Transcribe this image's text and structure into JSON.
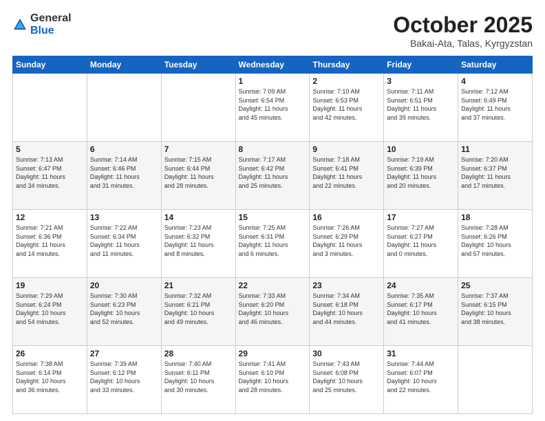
{
  "header": {
    "logo_general": "General",
    "logo_blue": "Blue",
    "month_title": "October 2025",
    "location": "Bakai-Ata, Talas, Kyrgyzstan"
  },
  "weekdays": [
    "Sunday",
    "Monday",
    "Tuesday",
    "Wednesday",
    "Thursday",
    "Friday",
    "Saturday"
  ],
  "weeks": [
    [
      {
        "day": "",
        "info": ""
      },
      {
        "day": "",
        "info": ""
      },
      {
        "day": "",
        "info": ""
      },
      {
        "day": "1",
        "info": "Sunrise: 7:09 AM\nSunset: 6:54 PM\nDaylight: 11 hours\nand 45 minutes."
      },
      {
        "day": "2",
        "info": "Sunrise: 7:10 AM\nSunset: 6:53 PM\nDaylight: 11 hours\nand 42 minutes."
      },
      {
        "day": "3",
        "info": "Sunrise: 7:11 AM\nSunset: 6:51 PM\nDaylight: 11 hours\nand 39 minutes."
      },
      {
        "day": "4",
        "info": "Sunrise: 7:12 AM\nSunset: 6:49 PM\nDaylight: 11 hours\nand 37 minutes."
      }
    ],
    [
      {
        "day": "5",
        "info": "Sunrise: 7:13 AM\nSunset: 6:47 PM\nDaylight: 11 hours\nand 34 minutes."
      },
      {
        "day": "6",
        "info": "Sunrise: 7:14 AM\nSunset: 6:46 PM\nDaylight: 11 hours\nand 31 minutes."
      },
      {
        "day": "7",
        "info": "Sunrise: 7:15 AM\nSunset: 6:44 PM\nDaylight: 11 hours\nand 28 minutes."
      },
      {
        "day": "8",
        "info": "Sunrise: 7:17 AM\nSunset: 6:42 PM\nDaylight: 11 hours\nand 25 minutes."
      },
      {
        "day": "9",
        "info": "Sunrise: 7:18 AM\nSunset: 6:41 PM\nDaylight: 11 hours\nand 22 minutes."
      },
      {
        "day": "10",
        "info": "Sunrise: 7:19 AM\nSunset: 6:39 PM\nDaylight: 11 hours\nand 20 minutes."
      },
      {
        "day": "11",
        "info": "Sunrise: 7:20 AM\nSunset: 6:37 PM\nDaylight: 11 hours\nand 17 minutes."
      }
    ],
    [
      {
        "day": "12",
        "info": "Sunrise: 7:21 AM\nSunset: 6:36 PM\nDaylight: 11 hours\nand 14 minutes."
      },
      {
        "day": "13",
        "info": "Sunrise: 7:22 AM\nSunset: 6:34 PM\nDaylight: 11 hours\nand 11 minutes."
      },
      {
        "day": "14",
        "info": "Sunrise: 7:23 AM\nSunset: 6:32 PM\nDaylight: 11 hours\nand 8 minutes."
      },
      {
        "day": "15",
        "info": "Sunrise: 7:25 AM\nSunset: 6:31 PM\nDaylight: 11 hours\nand 6 minutes."
      },
      {
        "day": "16",
        "info": "Sunrise: 7:26 AM\nSunset: 6:29 PM\nDaylight: 11 hours\nand 3 minutes."
      },
      {
        "day": "17",
        "info": "Sunrise: 7:27 AM\nSunset: 6:27 PM\nDaylight: 11 hours\nand 0 minutes."
      },
      {
        "day": "18",
        "info": "Sunrise: 7:28 AM\nSunset: 6:26 PM\nDaylight: 10 hours\nand 57 minutes."
      }
    ],
    [
      {
        "day": "19",
        "info": "Sunrise: 7:29 AM\nSunset: 6:24 PM\nDaylight: 10 hours\nand 54 minutes."
      },
      {
        "day": "20",
        "info": "Sunrise: 7:30 AM\nSunset: 6:23 PM\nDaylight: 10 hours\nand 52 minutes."
      },
      {
        "day": "21",
        "info": "Sunrise: 7:32 AM\nSunset: 6:21 PM\nDaylight: 10 hours\nand 49 minutes."
      },
      {
        "day": "22",
        "info": "Sunrise: 7:33 AM\nSunset: 6:20 PM\nDaylight: 10 hours\nand 46 minutes."
      },
      {
        "day": "23",
        "info": "Sunrise: 7:34 AM\nSunset: 6:18 PM\nDaylight: 10 hours\nand 44 minutes."
      },
      {
        "day": "24",
        "info": "Sunrise: 7:35 AM\nSunset: 6:17 PM\nDaylight: 10 hours\nand 41 minutes."
      },
      {
        "day": "25",
        "info": "Sunrise: 7:37 AM\nSunset: 6:15 PM\nDaylight: 10 hours\nand 38 minutes."
      }
    ],
    [
      {
        "day": "26",
        "info": "Sunrise: 7:38 AM\nSunset: 6:14 PM\nDaylight: 10 hours\nand 36 minutes."
      },
      {
        "day": "27",
        "info": "Sunrise: 7:39 AM\nSunset: 6:12 PM\nDaylight: 10 hours\nand 33 minutes."
      },
      {
        "day": "28",
        "info": "Sunrise: 7:40 AM\nSunset: 6:11 PM\nDaylight: 10 hours\nand 30 minutes."
      },
      {
        "day": "29",
        "info": "Sunrise: 7:41 AM\nSunset: 6:10 PM\nDaylight: 10 hours\nand 28 minutes."
      },
      {
        "day": "30",
        "info": "Sunrise: 7:43 AM\nSunset: 6:08 PM\nDaylight: 10 hours\nand 25 minutes."
      },
      {
        "day": "31",
        "info": "Sunrise: 7:44 AM\nSunset: 6:07 PM\nDaylight: 10 hours\nand 22 minutes."
      },
      {
        "day": "",
        "info": ""
      }
    ]
  ]
}
